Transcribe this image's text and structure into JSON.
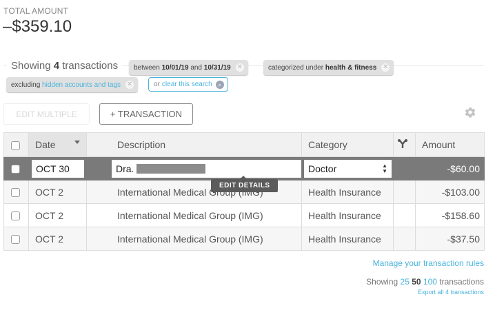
{
  "summary": {
    "total_label": "TOTAL AMOUNT",
    "total_value": "–$359.10"
  },
  "filters": {
    "showing_prefix": "Showing",
    "count": "4",
    "showing_suffix": "transactions",
    "date_chip": {
      "prefix": "between",
      "start": "10/01/19",
      "and": "and",
      "end": "10/31/19"
    },
    "category_chip": {
      "prefix": "categorized under",
      "value": "health & fitness"
    },
    "exclude_chip": {
      "prefix": "excluding",
      "link": "hidden accounts and tags"
    },
    "clear_chip": {
      "prefix": "or",
      "link": "clear this search"
    }
  },
  "toolbar": {
    "edit_multiple_label": "EDIT MULTIPLE",
    "add_transaction_label": "+ TRANSACTION"
  },
  "table": {
    "columns": {
      "date": "Date",
      "description": "Description",
      "category": "Category",
      "amount": "Amount"
    },
    "selected_row": {
      "date": "OCT 30",
      "description": "Dra.",
      "category": "Doctor",
      "amount": "-$60.00"
    },
    "rows": [
      {
        "date": "OCT 2",
        "description": "International Medical Group (IMG)",
        "category": "Health Insurance",
        "amount": "-$103.00"
      },
      {
        "date": "OCT 2",
        "description": "International Medical Group (IMG)",
        "category": "Health Insurance",
        "amount": "-$158.60"
      },
      {
        "date": "OCT 2",
        "description": "International Medical Group (IMG)",
        "category": "Health Insurance",
        "amount": "-$37.50"
      }
    ]
  },
  "tooltip": {
    "edit_details": "EDIT DETAILS"
  },
  "footer": {
    "manage_rules": "Manage your transaction rules",
    "showing": "Showing",
    "sizes": [
      "25",
      "50",
      "100"
    ],
    "transactions": "transactions",
    "export": "Export all 4 transactions"
  },
  "colors": {
    "accent": "#4ab3dc",
    "selected_row": "#7a7a7a"
  }
}
